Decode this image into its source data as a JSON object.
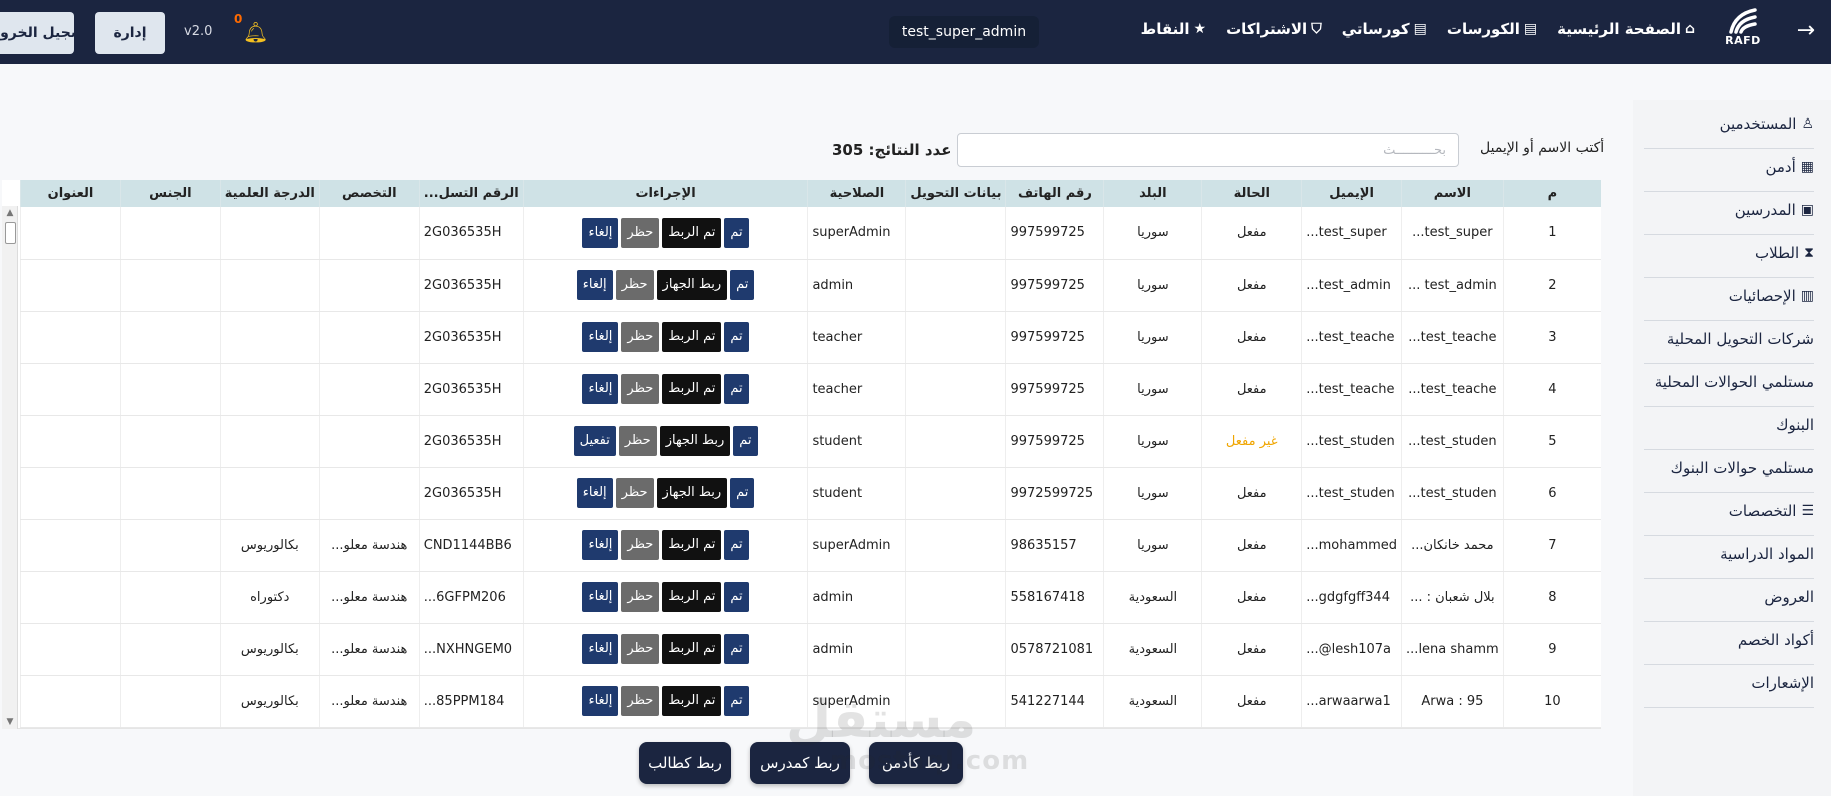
{
  "topbar": {
    "nav": [
      {
        "label": "الصفحة الرئيسية",
        "icon": "home-icon",
        "glyph": "⌂"
      },
      {
        "label": "الكورسات",
        "icon": "book-icon",
        "glyph": "▤"
      },
      {
        "label": "كورساتي",
        "icon": "book-stack-icon",
        "glyph": "▤"
      },
      {
        "label": "الاشتراكات",
        "icon": "tag-icon",
        "glyph": "⛉"
      },
      {
        "label": "النقاط",
        "icon": "star-icon",
        "glyph": "★"
      }
    ],
    "logo_text": "RAFD",
    "user": "test_super_admin",
    "notif_count": "0",
    "version": "v2.0",
    "admin_label": "إدارة",
    "logout_label": "تسجيل الخروج"
  },
  "sidebar": {
    "items": [
      {
        "label": "المستخدمين",
        "icon": "user-icon",
        "glyph": "♙"
      },
      {
        "label": "أدمن",
        "icon": "admin-icon",
        "glyph": "▦"
      },
      {
        "label": "المدرسين",
        "icon": "teacher-icon",
        "glyph": "▣"
      },
      {
        "label": "الطلاب",
        "icon": "student-icon",
        "glyph": "⧗"
      },
      {
        "label": "الإحصائيات",
        "icon": "chart-icon",
        "glyph": "▥"
      },
      {
        "label": "شركات التحويل المحلية",
        "icon": "",
        "glyph": ""
      },
      {
        "label": "مستلمي الحوالات المحلية",
        "icon": "",
        "glyph": ""
      },
      {
        "label": "البنوك",
        "icon": "",
        "glyph": ""
      },
      {
        "label": "مستلمي حوالات البنوك",
        "icon": "",
        "glyph": ""
      },
      {
        "label": "التخصصات",
        "icon": "list-icon",
        "glyph": "☰"
      },
      {
        "label": "المواد الدراسية",
        "icon": "",
        "glyph": ""
      },
      {
        "label": "العروض",
        "icon": "",
        "glyph": ""
      },
      {
        "label": "أكواد الخصم",
        "icon": "",
        "glyph": ""
      },
      {
        "label": "الإشعارات",
        "icon": "",
        "glyph": ""
      }
    ]
  },
  "search": {
    "label": "أكتب الاسم أو الإيميل",
    "placeholder": "بحــــــــــث",
    "value": "",
    "count_text": "عدد النتائج: 305"
  },
  "table": {
    "headers": [
      "م",
      "الاسم",
      "الإيميل",
      "الحالة",
      "البلد",
      "رقم الهاتف",
      "بيانات التحويل",
      "الصلاحية",
      "الإجراءات",
      "الرقم التسل...",
      "التخصص",
      "الدرجة العلمية",
      "الجنس",
      "العنوان"
    ],
    "rows": [
      {
        "n": "1",
        "name": "test_super...",
        "email": "test_super...",
        "status": "مفعل",
        "active": true,
        "country": "سوريا",
        "phone": "997599725",
        "transfer": "",
        "role": "superAdmin",
        "actions": [
          "إلغاء",
          "حظر",
          "تم الربط",
          "تم"
        ],
        "serial": "2G036535H",
        "spec": "",
        "degree": "",
        "gender": "",
        "address": ""
      },
      {
        "n": "2",
        "name": "test_admin ...",
        "email": "test_admin...",
        "status": "مفعل",
        "active": true,
        "country": "سوريا",
        "phone": "997599725",
        "transfer": "",
        "role": "admin",
        "actions": [
          "إلغاء",
          "حظر",
          "ربط الجهاز",
          "تم"
        ],
        "serial": "2G036535H",
        "spec": "",
        "degree": "",
        "gender": "",
        "address": ""
      },
      {
        "n": "3",
        "name": "test_teache...",
        "email": "test_teache...",
        "status": "مفعل",
        "active": true,
        "country": "سوريا",
        "phone": "997599725",
        "transfer": "",
        "role": "teacher",
        "actions": [
          "إلغاء",
          "حظر",
          "تم الربط",
          "تم"
        ],
        "serial": "2G036535H",
        "spec": "",
        "degree": "",
        "gender": "",
        "address": ""
      },
      {
        "n": "4",
        "name": "test_teache...",
        "email": "test_teache...",
        "status": "مفعل",
        "active": true,
        "country": "سوريا",
        "phone": "997599725",
        "transfer": "",
        "role": "teacher",
        "actions": [
          "إلغاء",
          "حظر",
          "تم الربط",
          "تم"
        ],
        "serial": "2G036535H",
        "spec": "",
        "degree": "",
        "gender": "",
        "address": ""
      },
      {
        "n": "5",
        "name": "test_studen...",
        "email": "test_studen...",
        "status": "غير مفعل",
        "active": false,
        "country": "سوريا",
        "phone": "997599725",
        "transfer": "",
        "role": "student",
        "actions": [
          "تفعيل",
          "حظر",
          "ربط الجهاز",
          "تم"
        ],
        "serial": "2G036535H",
        "spec": "",
        "degree": "",
        "gender": "",
        "address": ""
      },
      {
        "n": "6",
        "name": "test_studen...",
        "email": "test_studen...",
        "status": "مفعل",
        "active": true,
        "country": "سوريا",
        "phone": "9972599725",
        "transfer": "",
        "role": "student",
        "actions": [
          "إلغاء",
          "حظر",
          "ربط الجهاز",
          "تم"
        ],
        "serial": "2G036535H",
        "spec": "",
        "degree": "",
        "gender": "",
        "address": ""
      },
      {
        "n": "7",
        "name": "محمد خانكان...",
        "email": "mohammed...",
        "status": "مفعل",
        "active": true,
        "country": "سوريا",
        "phone": "98635157",
        "transfer": "",
        "role": "superAdmin",
        "actions": [
          "إلغاء",
          "حظر",
          "تم الربط",
          "تم"
        ],
        "serial": "CND1144BB6",
        "spec": "هندسة معلو...",
        "degree": "بكالوريوس",
        "gender": "",
        "address": ""
      },
      {
        "n": "8",
        "name": "بلال شعبان : ...",
        "email": "gdgfgff344...",
        "status": "مفعل",
        "active": true,
        "country": "السعودية",
        "phone": "558167418",
        "transfer": "",
        "role": "admin",
        "actions": [
          "إلغاء",
          "حظر",
          "تم الربط",
          "تم"
        ],
        "serial": "6GFPM206...",
        "spec": "هندسة معلو...",
        "degree": "دكتوراه",
        "gender": "",
        "address": ""
      },
      {
        "n": "9",
        "name": "lena shamm...",
        "email": "lesh107a@...",
        "status": "مفعل",
        "active": true,
        "country": "السعودية",
        "phone": "0578721081",
        "transfer": "",
        "role": "admin",
        "actions": [
          "إلغاء",
          "حظر",
          "تم الربط",
          "تم"
        ],
        "serial": "NXHNGEM0...",
        "spec": "هندسة معلو...",
        "degree": "بكالوريوس",
        "gender": "",
        "address": ""
      },
      {
        "n": "10",
        "name": "Arwa : 95",
        "email": "arwaarwa1...",
        "status": "مفعل",
        "active": true,
        "country": "السعودية",
        "phone": "541227144",
        "transfer": "",
        "role": "superAdmin",
        "actions": [
          "إلغاء",
          "حظر",
          "تم الربط",
          "تم"
        ],
        "serial": "85PPM184...",
        "spec": "هندسة معلو...",
        "degree": "بكالوريوس",
        "gender": "",
        "address": ""
      }
    ]
  },
  "bottom_buttons": [
    "ربط كأدمن",
    "ربط كمدرس",
    "ربط كطالب"
  ],
  "watermark": {
    "line1": "مستقل",
    "line2": "mostaql.com"
  },
  "colors": {
    "navy": "#1b2540",
    "table_header": "#cfe2e6",
    "action_blue": "#1f3a6e",
    "inactive": "#f0a500",
    "bell": "#f4c020",
    "badge": "#ff6a00"
  }
}
